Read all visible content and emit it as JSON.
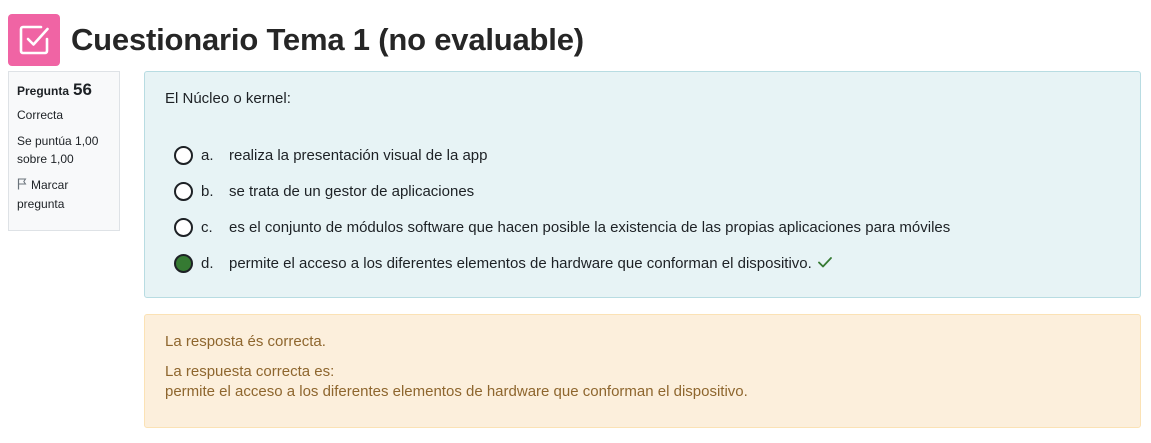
{
  "header": {
    "title": "Cuestionario Tema 1 (no evaluable)",
    "icon": "quiz-checkbox-icon",
    "icon_color": "#f064a4"
  },
  "info": {
    "question_label": "Pregunta",
    "question_number": "56",
    "state": "Correcta",
    "grade": "Se puntúa 1,00 sobre 1,00",
    "flag": "Marcar pregunta"
  },
  "question": {
    "text": "El Núcleo o kernel:",
    "options": [
      {
        "letter": "a.",
        "text": "realiza la presentación visual de la app",
        "selected": false
      },
      {
        "letter": "b.",
        "text": "se trata de un gestor de aplicaciones",
        "selected": false
      },
      {
        "letter": "c.",
        "text": "es el conjunto de módulos software que hacen posible la existencia de las propias aplicaciones para móviles",
        "selected": false
      },
      {
        "letter": "d.",
        "text": "permite el acceso a los diferentes elementos de hardware que conforman el dispositivo.",
        "selected": true,
        "correct": true
      }
    ]
  },
  "feedback": {
    "specific": "La resposta és correcta.",
    "right_answer_label": "La respuesta correcta es:",
    "right_answer": "permite el acceso a los diferentes elementos de hardware que conforman el dispositivo."
  },
  "colors": {
    "question_bg": "#e7f3f5",
    "feedback_bg": "#fcefdc",
    "feedback_text": "#8e662e",
    "correct_green": "#357a32"
  }
}
